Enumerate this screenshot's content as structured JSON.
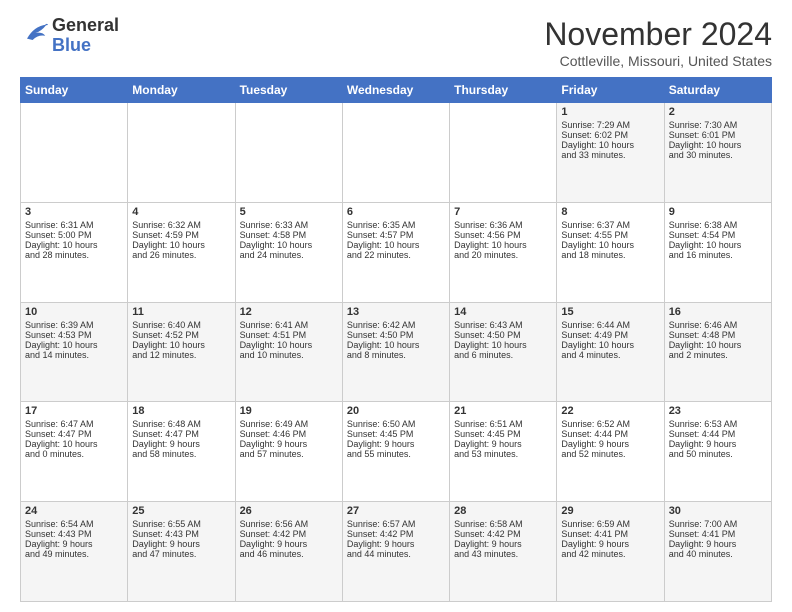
{
  "logo": {
    "general": "General",
    "blue": "Blue"
  },
  "header": {
    "month": "November 2024",
    "location": "Cottleville, Missouri, United States"
  },
  "days_of_week": [
    "Sunday",
    "Monday",
    "Tuesday",
    "Wednesday",
    "Thursday",
    "Friday",
    "Saturday"
  ],
  "weeks": [
    [
      {
        "day": "",
        "content": ""
      },
      {
        "day": "",
        "content": ""
      },
      {
        "day": "",
        "content": ""
      },
      {
        "day": "",
        "content": ""
      },
      {
        "day": "",
        "content": ""
      },
      {
        "day": "1",
        "content": "Sunrise: 7:29 AM\nSunset: 6:02 PM\nDaylight: 10 hours\nand 33 minutes."
      },
      {
        "day": "2",
        "content": "Sunrise: 7:30 AM\nSunset: 6:01 PM\nDaylight: 10 hours\nand 30 minutes."
      }
    ],
    [
      {
        "day": "3",
        "content": "Sunrise: 6:31 AM\nSunset: 5:00 PM\nDaylight: 10 hours\nand 28 minutes."
      },
      {
        "day": "4",
        "content": "Sunrise: 6:32 AM\nSunset: 4:59 PM\nDaylight: 10 hours\nand 26 minutes."
      },
      {
        "day": "5",
        "content": "Sunrise: 6:33 AM\nSunset: 4:58 PM\nDaylight: 10 hours\nand 24 minutes."
      },
      {
        "day": "6",
        "content": "Sunrise: 6:35 AM\nSunset: 4:57 PM\nDaylight: 10 hours\nand 22 minutes."
      },
      {
        "day": "7",
        "content": "Sunrise: 6:36 AM\nSunset: 4:56 PM\nDaylight: 10 hours\nand 20 minutes."
      },
      {
        "day": "8",
        "content": "Sunrise: 6:37 AM\nSunset: 4:55 PM\nDaylight: 10 hours\nand 18 minutes."
      },
      {
        "day": "9",
        "content": "Sunrise: 6:38 AM\nSunset: 4:54 PM\nDaylight: 10 hours\nand 16 minutes."
      }
    ],
    [
      {
        "day": "10",
        "content": "Sunrise: 6:39 AM\nSunset: 4:53 PM\nDaylight: 10 hours\nand 14 minutes."
      },
      {
        "day": "11",
        "content": "Sunrise: 6:40 AM\nSunset: 4:52 PM\nDaylight: 10 hours\nand 12 minutes."
      },
      {
        "day": "12",
        "content": "Sunrise: 6:41 AM\nSunset: 4:51 PM\nDaylight: 10 hours\nand 10 minutes."
      },
      {
        "day": "13",
        "content": "Sunrise: 6:42 AM\nSunset: 4:50 PM\nDaylight: 10 hours\nand 8 minutes."
      },
      {
        "day": "14",
        "content": "Sunrise: 6:43 AM\nSunset: 4:50 PM\nDaylight: 10 hours\nand 6 minutes."
      },
      {
        "day": "15",
        "content": "Sunrise: 6:44 AM\nSunset: 4:49 PM\nDaylight: 10 hours\nand 4 minutes."
      },
      {
        "day": "16",
        "content": "Sunrise: 6:46 AM\nSunset: 4:48 PM\nDaylight: 10 hours\nand 2 minutes."
      }
    ],
    [
      {
        "day": "17",
        "content": "Sunrise: 6:47 AM\nSunset: 4:47 PM\nDaylight: 10 hours\nand 0 minutes."
      },
      {
        "day": "18",
        "content": "Sunrise: 6:48 AM\nSunset: 4:47 PM\nDaylight: 9 hours\nand 58 minutes."
      },
      {
        "day": "19",
        "content": "Sunrise: 6:49 AM\nSunset: 4:46 PM\nDaylight: 9 hours\nand 57 minutes."
      },
      {
        "day": "20",
        "content": "Sunrise: 6:50 AM\nSunset: 4:45 PM\nDaylight: 9 hours\nand 55 minutes."
      },
      {
        "day": "21",
        "content": "Sunrise: 6:51 AM\nSunset: 4:45 PM\nDaylight: 9 hours\nand 53 minutes."
      },
      {
        "day": "22",
        "content": "Sunrise: 6:52 AM\nSunset: 4:44 PM\nDaylight: 9 hours\nand 52 minutes."
      },
      {
        "day": "23",
        "content": "Sunrise: 6:53 AM\nSunset: 4:44 PM\nDaylight: 9 hours\nand 50 minutes."
      }
    ],
    [
      {
        "day": "24",
        "content": "Sunrise: 6:54 AM\nSunset: 4:43 PM\nDaylight: 9 hours\nand 49 minutes."
      },
      {
        "day": "25",
        "content": "Sunrise: 6:55 AM\nSunset: 4:43 PM\nDaylight: 9 hours\nand 47 minutes."
      },
      {
        "day": "26",
        "content": "Sunrise: 6:56 AM\nSunset: 4:42 PM\nDaylight: 9 hours\nand 46 minutes."
      },
      {
        "day": "27",
        "content": "Sunrise: 6:57 AM\nSunset: 4:42 PM\nDaylight: 9 hours\nand 44 minutes."
      },
      {
        "day": "28",
        "content": "Sunrise: 6:58 AM\nSunset: 4:42 PM\nDaylight: 9 hours\nand 43 minutes."
      },
      {
        "day": "29",
        "content": "Sunrise: 6:59 AM\nSunset: 4:41 PM\nDaylight: 9 hours\nand 42 minutes."
      },
      {
        "day": "30",
        "content": "Sunrise: 7:00 AM\nSunset: 4:41 PM\nDaylight: 9 hours\nand 40 minutes."
      }
    ]
  ]
}
